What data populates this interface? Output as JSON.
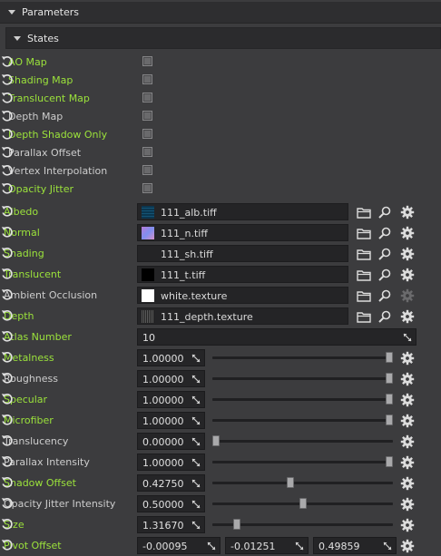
{
  "panel": {
    "title": "Parameters"
  },
  "states": {
    "title": "States",
    "items": [
      {
        "label": "AO Map",
        "green": true
      },
      {
        "label": "Shading Map",
        "green": true
      },
      {
        "label": "Translucent Map",
        "green": true
      },
      {
        "label": "Depth Map",
        "green": false
      },
      {
        "label": "Depth Shadow Only",
        "green": true
      },
      {
        "label": "Parallax Offset",
        "green": false
      },
      {
        "label": "Vertex Interpolation",
        "green": false
      },
      {
        "label": "Opacity Jitter",
        "green": true
      }
    ]
  },
  "textures": [
    {
      "label": "Albedo",
      "value": "111_alb.tiff",
      "green": true,
      "thumb": "albedo",
      "gear_disabled": false
    },
    {
      "label": "Normal",
      "value": "111_n.tiff",
      "green": true,
      "thumb": "normal",
      "gear_disabled": false
    },
    {
      "label": "Shading",
      "value": "111_sh.tiff",
      "green": true,
      "thumb": "none",
      "gear_disabled": false
    },
    {
      "label": "Translucent",
      "value": "111_t.tiff",
      "green": true,
      "thumb": "black",
      "gear_disabled": false
    },
    {
      "label": "Ambient Occlusion",
      "value": "white.texture",
      "green": false,
      "thumb": "white",
      "gear_disabled": true
    },
    {
      "label": "Depth",
      "value": "111_depth.texture",
      "green": true,
      "thumb": "depth",
      "gear_disabled": false
    }
  ],
  "atlas": {
    "label": "Atlas Number",
    "value": "10",
    "green": true
  },
  "sliders": [
    {
      "label": "Metalness",
      "value": "1.00000",
      "green": true,
      "pos": 1.0
    },
    {
      "label": "Roughness",
      "value": "1.00000",
      "green": false,
      "pos": 1.0
    },
    {
      "label": "Specular",
      "value": "1.00000",
      "green": true,
      "pos": 1.0
    },
    {
      "label": "Microfiber",
      "value": "1.00000",
      "green": true,
      "pos": 1.0
    },
    {
      "label": "Translucency",
      "value": "0.00000",
      "green": false,
      "pos": 0.0
    },
    {
      "label": "Parallax Intensity",
      "value": "1.00000",
      "green": false,
      "pos": 1.0
    },
    {
      "label": "Shadow Offset",
      "value": "0.42750",
      "green": true,
      "pos": 0.4275
    },
    {
      "label": "Opacity Jitter Intensity",
      "value": "0.50000",
      "green": false,
      "pos": 0.5
    },
    {
      "label": "Size",
      "value": "1.31670",
      "green": true,
      "pos": 0.12
    }
  ],
  "pivot": {
    "label": "Pivot Offset",
    "values": [
      "-0.00095",
      "-0.01251",
      "0.49859"
    ],
    "green": true
  },
  "colors": {
    "green_label": "#9be23b",
    "normal_label": "#cdcdcd",
    "background": "#3c3c3e"
  },
  "icons": {
    "folder": "folder-icon",
    "search": "magnifier-icon",
    "gear": "gear-icon",
    "reset": "reset-icon",
    "expand": "resize-arrows-icon"
  }
}
